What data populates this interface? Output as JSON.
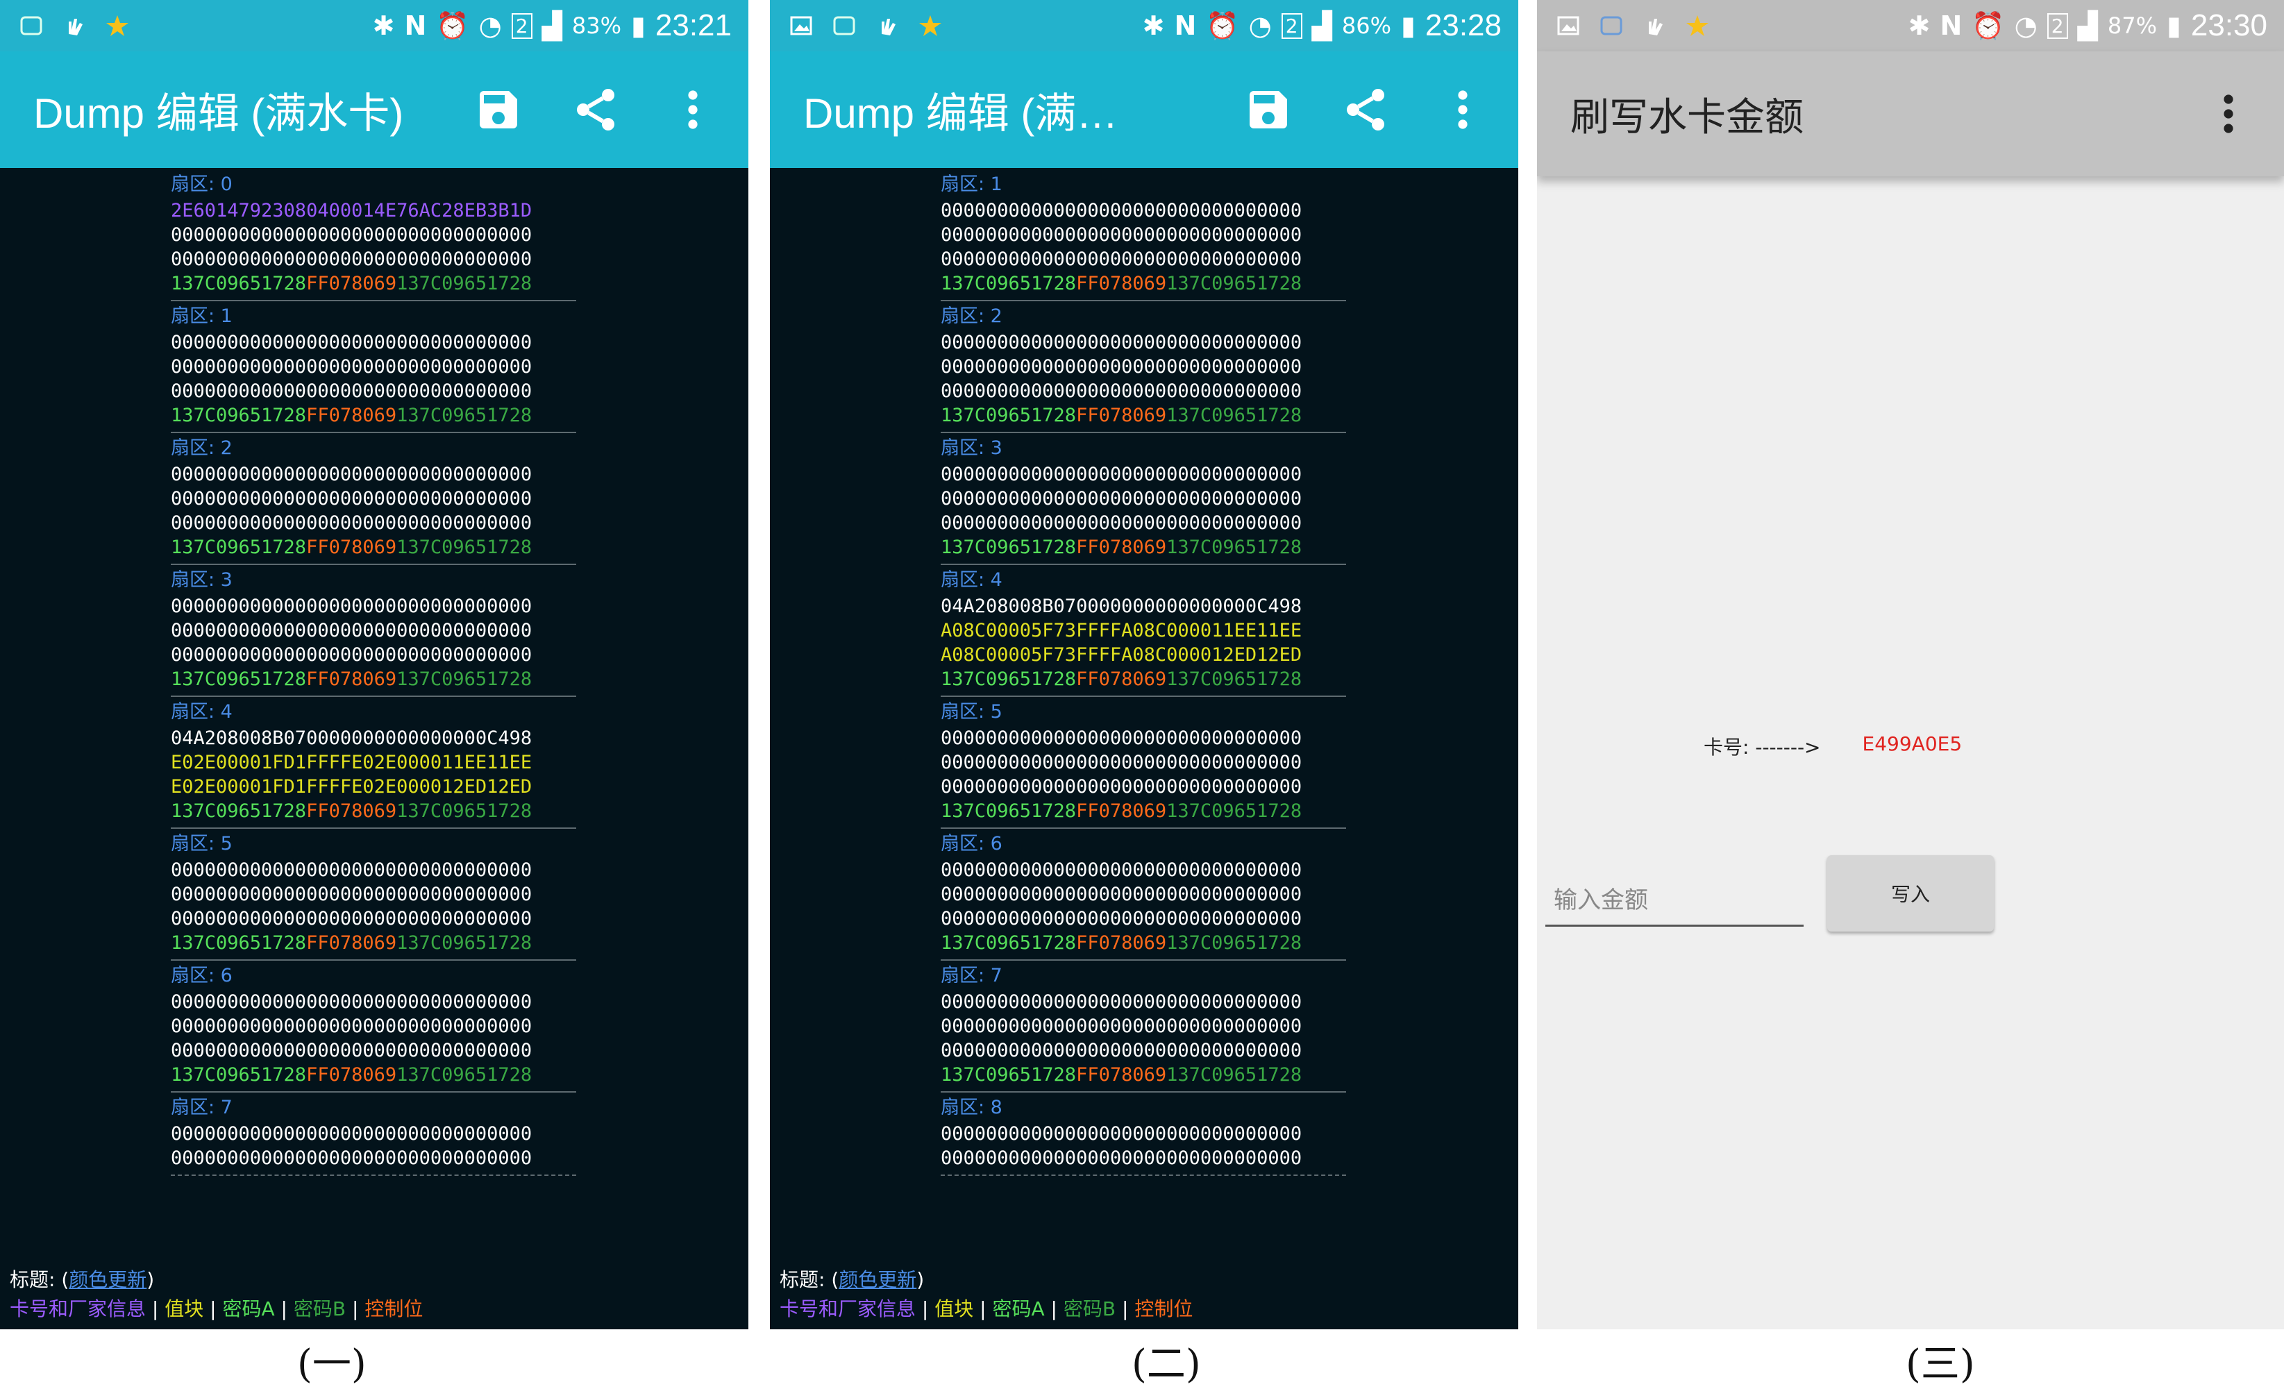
{
  "colors": {
    "status_bar": "#23b2cc",
    "app_bar": "#1cb6d0",
    "dump_bg": "#03131b",
    "sector_header": "#4a8ce6",
    "uid": "#9b5cff",
    "value_block": "#e0e020",
    "key_a": "#56e05a",
    "control_bits": "#ff6a1a",
    "key_b": "#3aa944",
    "card_number": "#e0231f"
  },
  "phone1": {
    "status": {
      "battery": "83%",
      "time": "23:21",
      "sim": "2"
    },
    "title": "Dump 编辑 (满水卡)",
    "icons": [
      "save-icon",
      "share-icon",
      "more-vert-icon"
    ],
    "sectors": [
      {
        "header": "扇区: 0",
        "lines": [
          {
            "text": "2E60147923080400014E76AC28EB3B1D",
            "type": "uid"
          },
          {
            "text": "00000000000000000000000000000000",
            "type": "data"
          },
          {
            "text": "00000000000000000000000000000000",
            "type": "data"
          }
        ],
        "trailer": {
          "a": "137C09651728",
          "ctl": "FF078069",
          "b": "137C09651728"
        }
      },
      {
        "header": "扇区: 1",
        "lines": [
          {
            "text": "00000000000000000000000000000000",
            "type": "data"
          },
          {
            "text": "00000000000000000000000000000000",
            "type": "data"
          },
          {
            "text": "00000000000000000000000000000000",
            "type": "data"
          }
        ],
        "trailer": {
          "a": "137C09651728",
          "ctl": "FF078069",
          "b": "137C09651728"
        }
      },
      {
        "header": "扇区: 2",
        "lines": [
          {
            "text": "00000000000000000000000000000000",
            "type": "data"
          },
          {
            "text": "00000000000000000000000000000000",
            "type": "data"
          },
          {
            "text": "00000000000000000000000000000000",
            "type": "data"
          }
        ],
        "trailer": {
          "a": "137C09651728",
          "ctl": "FF078069",
          "b": "137C09651728"
        }
      },
      {
        "header": "扇区: 3",
        "lines": [
          {
            "text": "00000000000000000000000000000000",
            "type": "data"
          },
          {
            "text": "00000000000000000000000000000000",
            "type": "data"
          },
          {
            "text": "00000000000000000000000000000000",
            "type": "data"
          }
        ],
        "trailer": {
          "a": "137C09651728",
          "ctl": "FF078069",
          "b": "137C09651728"
        }
      },
      {
        "header": "扇区: 4",
        "lines": [
          {
            "text": "04A208008B070000000000000000C498",
            "type": "data"
          },
          {
            "text": "E02E00001FD1FFFFE02E000011EE11EE",
            "type": "value"
          },
          {
            "text": "E02E00001FD1FFFFE02E000012ED12ED",
            "type": "value"
          }
        ],
        "trailer": {
          "a": "137C09651728",
          "ctl": "FF078069",
          "b": "137C09651728"
        }
      },
      {
        "header": "扇区: 5",
        "lines": [
          {
            "text": "00000000000000000000000000000000",
            "type": "data"
          },
          {
            "text": "00000000000000000000000000000000",
            "type": "data"
          },
          {
            "text": "00000000000000000000000000000000",
            "type": "data"
          }
        ],
        "trailer": {
          "a": "137C09651728",
          "ctl": "FF078069",
          "b": "137C09651728"
        }
      },
      {
        "header": "扇区: 6",
        "lines": [
          {
            "text": "00000000000000000000000000000000",
            "type": "data"
          },
          {
            "text": "00000000000000000000000000000000",
            "type": "data"
          },
          {
            "text": "00000000000000000000000000000000",
            "type": "data"
          }
        ],
        "trailer": {
          "a": "137C09651728",
          "ctl": "FF078069",
          "b": "137C09651728"
        }
      },
      {
        "header": "扇区: 7",
        "lines": [
          {
            "text": "00000000000000000000000000000000",
            "type": "data"
          },
          {
            "text": "00000000000000000000000000000000",
            "type": "data"
          }
        ],
        "trailer": null
      }
    ],
    "legend": {
      "title_label": "标题: (",
      "color_update": "颜色更新",
      "close_paren": ")",
      "uid": "卡号和厂家信息",
      "value": "值块",
      "key_a": "密码A",
      "key_b": "密码B",
      "control": "控制位",
      "sep": " | "
    },
    "caption": "(一)"
  },
  "phone2": {
    "status": {
      "battery": "86%",
      "time": "23:28",
      "sim": "2"
    },
    "title": "Dump 编辑 (满水...",
    "icons": [
      "save-icon",
      "share-icon",
      "more-vert-icon"
    ],
    "sectors": [
      {
        "header": "扇区: 1",
        "lines": [
          {
            "text": "00000000000000000000000000000000",
            "type": "data"
          },
          {
            "text": "00000000000000000000000000000000",
            "type": "data"
          },
          {
            "text": "00000000000000000000000000000000",
            "type": "data"
          }
        ],
        "trailer": {
          "a": "137C09651728",
          "ctl": "FF078069",
          "b": "137C09651728"
        }
      },
      {
        "header": "扇区: 2",
        "lines": [
          {
            "text": "00000000000000000000000000000000",
            "type": "data"
          },
          {
            "text": "00000000000000000000000000000000",
            "type": "data"
          },
          {
            "text": "00000000000000000000000000000000",
            "type": "data"
          }
        ],
        "trailer": {
          "a": "137C09651728",
          "ctl": "FF078069",
          "b": "137C09651728"
        }
      },
      {
        "header": "扇区: 3",
        "lines": [
          {
            "text": "00000000000000000000000000000000",
            "type": "data"
          },
          {
            "text": "00000000000000000000000000000000",
            "type": "data"
          },
          {
            "text": "00000000000000000000000000000000",
            "type": "data"
          }
        ],
        "trailer": {
          "a": "137C09651728",
          "ctl": "FF078069",
          "b": "137C09651728"
        }
      },
      {
        "header": "扇区: 4",
        "lines": [
          {
            "text": "04A208008B070000000000000000C498",
            "type": "data"
          },
          {
            "text": "A08C00005F73FFFFA08C000011EE11EE",
            "type": "value"
          },
          {
            "text": "A08C00005F73FFFFA08C000012ED12ED",
            "type": "value"
          }
        ],
        "trailer": {
          "a": "137C09651728",
          "ctl": "FF078069",
          "b": "137C09651728"
        }
      },
      {
        "header": "扇区: 5",
        "lines": [
          {
            "text": "00000000000000000000000000000000",
            "type": "data"
          },
          {
            "text": "00000000000000000000000000000000",
            "type": "data"
          },
          {
            "text": "00000000000000000000000000000000",
            "type": "data"
          }
        ],
        "trailer": {
          "a": "137C09651728",
          "ctl": "FF078069",
          "b": "137C09651728"
        }
      },
      {
        "header": "扇区: 6",
        "lines": [
          {
            "text": "00000000000000000000000000000000",
            "type": "data"
          },
          {
            "text": "00000000000000000000000000000000",
            "type": "data"
          },
          {
            "text": "00000000000000000000000000000000",
            "type": "data"
          }
        ],
        "trailer": {
          "a": "137C09651728",
          "ctl": "FF078069",
          "b": "137C09651728"
        }
      },
      {
        "header": "扇区: 7",
        "lines": [
          {
            "text": "00000000000000000000000000000000",
            "type": "data"
          },
          {
            "text": "00000000000000000000000000000000",
            "type": "data"
          },
          {
            "text": "00000000000000000000000000000000",
            "type": "data"
          }
        ],
        "trailer": {
          "a": "137C09651728",
          "ctl": "FF078069",
          "b": "137C09651728"
        }
      },
      {
        "header": "扇区: 8",
        "lines": [
          {
            "text": "00000000000000000000000000000000",
            "type": "data"
          },
          {
            "text": "00000000000000000000000000000000",
            "type": "data"
          }
        ],
        "trailer": null
      }
    ],
    "legend": {
      "title_label": "标题: (",
      "color_update": "颜色更新",
      "close_paren": ")",
      "uid": "卡号和厂家信息",
      "value": "值块",
      "key_a": "密码A",
      "key_b": "密码B",
      "control": "控制位",
      "sep": " | "
    },
    "caption": "(二)"
  },
  "phone3": {
    "status": {
      "battery": "87%",
      "time": "23:30",
      "sim": "2"
    },
    "title": "刷写水卡金额",
    "card_label": "卡号: ------->",
    "card_number": "E499A0E5",
    "amount_placeholder": "输入金额",
    "write_button": "写入",
    "caption": "(三)"
  }
}
